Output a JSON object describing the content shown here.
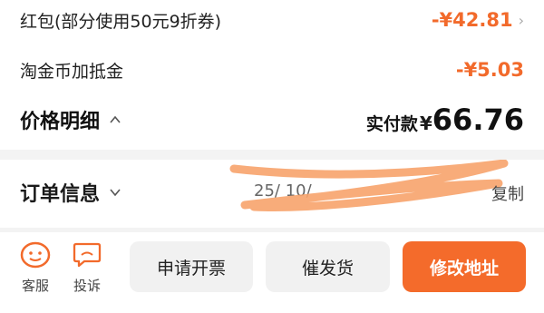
{
  "price_rows": [
    {
      "label": "红包(部分使用50元9折券)",
      "amount": "-¥42.81"
    },
    {
      "label": "淘金币加抵金",
      "amount": "-¥5.03"
    }
  ],
  "price_detail": {
    "title": "价格明细",
    "paid_label": "实付款",
    "currency": "¥",
    "paid_value": "66.76"
  },
  "order_info": {
    "title": "订单信息",
    "order_number_partial": "25/  10/",
    "copy_label": "复制"
  },
  "bottom_bar": {
    "service_label": "客服",
    "complain_label": "投诉",
    "invoice_button": "申请开票",
    "urge_button": "催发货",
    "modify_address_button": "修改地址"
  },
  "colors": {
    "accent": "#f26a2b",
    "primary_button": "#f46b2b",
    "scribble": "#f7a36b"
  }
}
